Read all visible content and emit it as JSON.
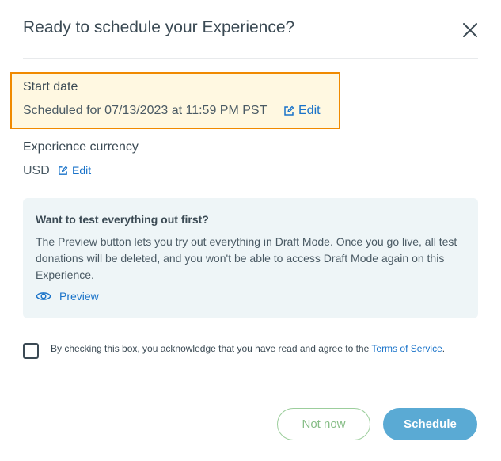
{
  "dialog": {
    "title": "Ready to schedule your Experience?"
  },
  "start_date": {
    "label": "Start date",
    "value": "Scheduled for 07/13/2023 at 11:59 PM PST",
    "edit_label": "Edit"
  },
  "currency": {
    "label": "Experience currency",
    "value": "USD",
    "edit_label": "Edit"
  },
  "info": {
    "title": "Want to test everything out first?",
    "body": "The Preview button lets you try out everything in Draft Mode. Once you go live, all test donations will be deleted, and you won't be able to access Draft Mode again on this Experience.",
    "preview_label": "Preview"
  },
  "terms": {
    "text": "By checking this box, you acknowledge that you have read and agree to the ",
    "link_label": "Terms of Service",
    "suffix": ".",
    "checked": false
  },
  "actions": {
    "secondary_label": "Not now",
    "primary_label": "Schedule"
  },
  "colors": {
    "accent": "#1a73c9",
    "highlight_border": "#f08a00",
    "highlight_bg": "#fff8e1",
    "primary_button": "#5aaad4",
    "secondary_button": "#86bd86"
  }
}
